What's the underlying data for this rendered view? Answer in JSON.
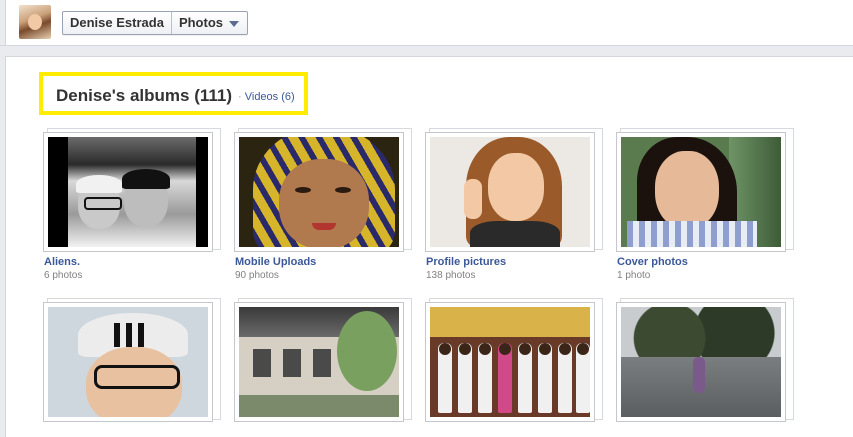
{
  "header": {
    "user_name": "Denise Estrada",
    "section_label": "Photos"
  },
  "albums_header": {
    "title": "Denise's albums (111)",
    "separator": "·",
    "videos_link": "Videos (6)"
  },
  "albums": [
    {
      "title": "Aliens.",
      "count": "6 photos"
    },
    {
      "title": "Mobile Uploads",
      "count": "90 photos"
    },
    {
      "title": "Profile pictures",
      "count": "138 photos"
    },
    {
      "title": "Cover photos",
      "count": "1 photo"
    }
  ],
  "colors": {
    "link": "#3b5998",
    "highlight_box": "#ffec00",
    "page_bg": "#e9ebee"
  }
}
